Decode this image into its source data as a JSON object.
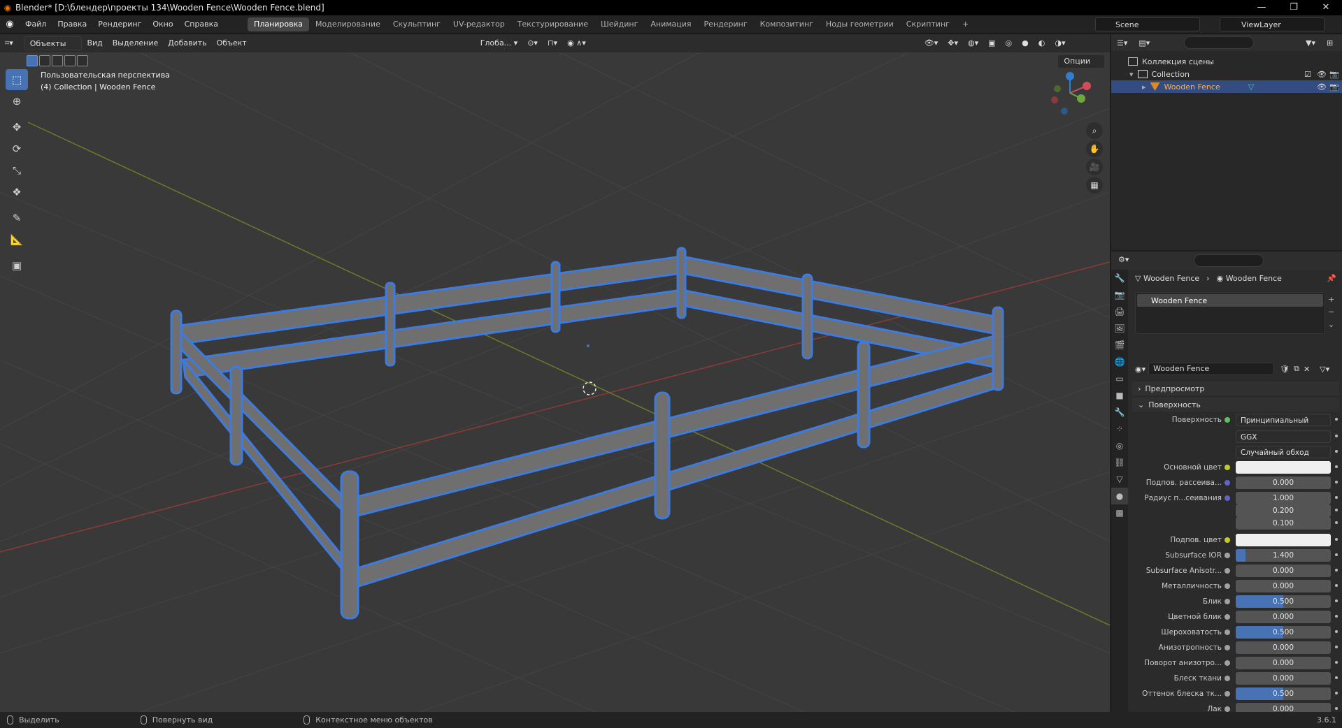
{
  "window": {
    "title": "Blender* [D:\\блендер\\проекты 134\\Wooden Fence\\Wooden Fence.blend]",
    "controls": [
      "—",
      "❐",
      "✕"
    ]
  },
  "menu": [
    "Файл",
    "Правка",
    "Рендеринг",
    "Окно",
    "Справка"
  ],
  "workspaces": [
    "Планировка",
    "Моделирование",
    "Скульптинг",
    "UV-редактор",
    "Текстурирование",
    "Шейдинг",
    "Анимация",
    "Рендеринг",
    "Композитинг",
    "Ноды геометрии",
    "Скриптинг",
    "+"
  ],
  "scene": "Scene",
  "view_layer": "ViewLayer",
  "viewport": {
    "mode": "Объекты",
    "menus": [
      "Вид",
      "Выделение",
      "Добавить",
      "Объект"
    ],
    "orientation": "Глоба...",
    "options": "Опции",
    "info_line1": "Пользовательская перспектива",
    "info_line2": "(4) Collection | Wooden Fence"
  },
  "outliner": {
    "rows": [
      {
        "label": "Коллекция сцены"
      },
      {
        "label": "Collection"
      },
      {
        "label": "Wooden Fence"
      }
    ]
  },
  "properties": {
    "crumb_object": "Wooden Fence",
    "crumb_material": "Wooden Fence",
    "slot": "Wooden Fence",
    "material": "Wooden Fence",
    "panel_preview": "Предпросмотр",
    "panel_surface": "Поверхность",
    "rows": [
      {
        "label": "Поверхность",
        "value": "Принципиальный BSDF",
        "kind": "enum",
        "dot": "#5fbf5f"
      },
      {
        "label": "",
        "value": "GGX",
        "kind": "enum",
        "dot": ""
      },
      {
        "label": "",
        "value": "Случайный обход",
        "kind": "enum",
        "dot": ""
      },
      {
        "label": "Основной цвет",
        "value": "",
        "kind": "color",
        "dot": "#c7c729"
      },
      {
        "label": "Подпов. рассеива...",
        "value": "0.000",
        "kind": "num",
        "dot": "#6363c7",
        "fill": 0
      },
      {
        "label": "Радиус п...сеивания",
        "value": "1.000",
        "kind": "num",
        "dot": "#6363c7",
        "fill": 0
      },
      {
        "label": "",
        "value": "0.200",
        "kind": "num",
        "dot": "",
        "fill": 0
      },
      {
        "label": "",
        "value": "0.100",
        "kind": "num",
        "dot": "",
        "fill": 0
      },
      {
        "label": "Подпов. цвет",
        "value": "",
        "kind": "color",
        "dot": "#c7c729"
      },
      {
        "label": "Subsurface IOR",
        "value": "1.400",
        "kind": "num",
        "dot": "#a1a1a1",
        "fill": 0.1
      },
      {
        "label": "Subsurface Anisotr...",
        "value": "0.000",
        "kind": "num",
        "dot": "#a1a1a1",
        "fill": 0
      },
      {
        "label": "Металличность",
        "value": "0.000",
        "kind": "num",
        "dot": "#a1a1a1",
        "fill": 0
      },
      {
        "label": "Блик",
        "value": "0.500",
        "kind": "num",
        "dot": "#a1a1a1",
        "fill": 0.5
      },
      {
        "label": "Цветной блик",
        "value": "0.000",
        "kind": "num",
        "dot": "#a1a1a1",
        "fill": 0
      },
      {
        "label": "Шероховатость",
        "value": "0.500",
        "kind": "num",
        "dot": "#a1a1a1",
        "fill": 0.5
      },
      {
        "label": "Анизотропность",
        "value": "0.000",
        "kind": "num",
        "dot": "#a1a1a1",
        "fill": 0
      },
      {
        "label": "Поворот анизотро...",
        "value": "0.000",
        "kind": "num",
        "dot": "#a1a1a1",
        "fill": 0
      },
      {
        "label": "Блеск ткани",
        "value": "0.000",
        "kind": "num",
        "dot": "#a1a1a1",
        "fill": 0
      },
      {
        "label": "Оттенок блеска тк...",
        "value": "0.500",
        "kind": "num",
        "dot": "#a1a1a1",
        "fill": 0.5
      },
      {
        "label": "Лак",
        "value": "0.000",
        "kind": "num",
        "dot": "#a1a1a1",
        "fill": 0
      }
    ]
  },
  "status": {
    "select": "Выделить",
    "rotate": "Повернуть вид",
    "context": "Контекстное меню объектов",
    "version": "3.6.1"
  },
  "colors": {
    "accent": "#4772b3",
    "selection_outline": "#3d7be0",
    "fence": "#6f6f6f"
  }
}
